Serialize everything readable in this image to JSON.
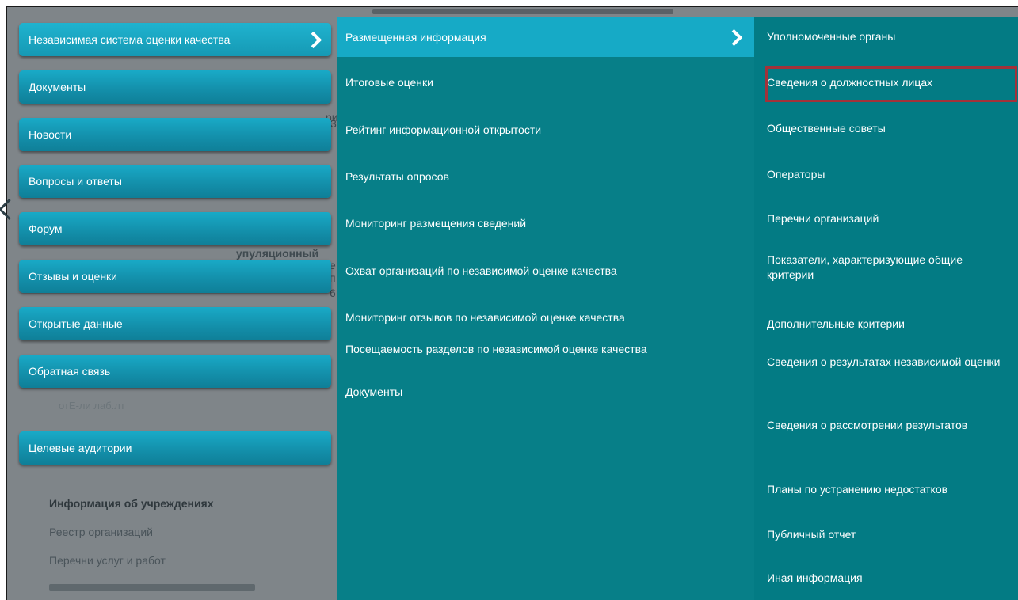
{
  "background": {
    "fragments": [
      "ри",
      "упуляционный",
      "е",
      "п",
      "3",
      "6",
      "отЕ-ли лаб.лт"
    ],
    "subitems": [
      "Информация об учреждениях",
      "Реестр организаций",
      "Перечни услуг и работ"
    ]
  },
  "menu_level1": {
    "items": [
      {
        "label": "Независимая система оценки качества"
      },
      {
        "label": "Документы"
      },
      {
        "label": "Новости"
      },
      {
        "label": "Вопросы и ответы"
      },
      {
        "label": "Форум"
      },
      {
        "label": "Отзывы и оценки"
      },
      {
        "label": "Открытые данные"
      },
      {
        "label": "Обратная связь"
      },
      {
        "label": "Целевые аудитории"
      }
    ]
  },
  "menu_level2": {
    "header": "Размещенная информация",
    "items": [
      "Итоговые оценки",
      "Рейтинг информационной открытости",
      "Результаты опросов",
      "Мониторинг размещения сведений",
      "Охват организаций по независимой оценке качества",
      "Мониторинг отзывов по независимой оценке качества",
      "Посещаемость разделов по независимой оценке качества",
      "Документы"
    ]
  },
  "menu_level3": {
    "items": [
      "Уполномоченные органы",
      "Сведения о должностных лицах",
      "Общественные советы",
      "Операторы",
      "Перечни организаций",
      "Показатели, характеризующие общие критерии",
      "Дополнительные критерии",
      "Сведения о результатах независимой оценки",
      "Сведения о рассмотрении результатов",
      "Планы по устранению недостатков",
      "Публичный отчет",
      "Иная информация"
    ],
    "highlighted_index": 1
  },
  "colors": {
    "button_top": "#19aac7",
    "button_bottom": "#0f7f98",
    "panel2": "#077f88",
    "panel3": "#037b84",
    "highlight_border": "#a2323a",
    "overlay": "#7f8589"
  }
}
